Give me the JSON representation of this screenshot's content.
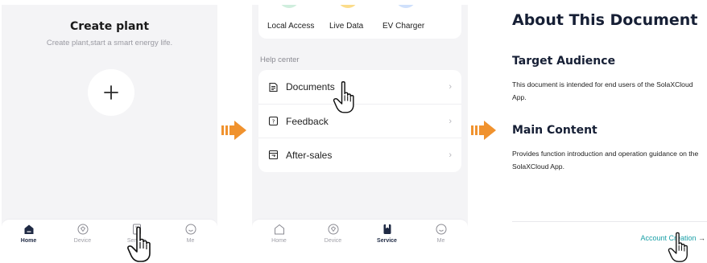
{
  "panel1": {
    "title": "Create plant",
    "subtitle": "Create plant,start a smart energy life.",
    "tabs": [
      {
        "label": "Home",
        "icon": "home-icon",
        "active": true
      },
      {
        "label": "Device",
        "icon": "device-icon",
        "active": false
      },
      {
        "label": "Service",
        "icon": "service-icon",
        "active": false
      },
      {
        "label": "Me",
        "icon": "me-icon",
        "active": false
      }
    ]
  },
  "panel2": {
    "top_items": [
      "Local Access",
      "Live Data",
      "EV Charger"
    ],
    "help_center_label": "Help center",
    "help_items": [
      {
        "label": "Documents",
        "icon": "document-icon"
      },
      {
        "label": "Feedback",
        "icon": "feedback-icon"
      },
      {
        "label": "After-sales",
        "icon": "after-sales-icon"
      }
    ],
    "tabs": [
      {
        "label": "Home",
        "icon": "home-icon",
        "active": false
      },
      {
        "label": "Device",
        "icon": "device-icon",
        "active": false
      },
      {
        "label": "Service",
        "icon": "service-icon",
        "active": true
      },
      {
        "label": "Me",
        "icon": "me-icon",
        "active": false
      }
    ]
  },
  "panel3": {
    "title": "About This Document",
    "sections": [
      {
        "heading": "Target Audience",
        "body": "This document is intended for end users of the SolaXCloud App."
      },
      {
        "heading": "Main Content",
        "body": "Provides function introduction and operation guidance on the SolaXCloud App."
      }
    ],
    "next_link": "Account Creation",
    "next_arrow": "→"
  },
  "colors": {
    "flow_arrow": "#f0922e",
    "accent_teal": "#1ba0a7",
    "nav_active": "#1f2a44",
    "panel_bg": "#f4f4f6"
  }
}
